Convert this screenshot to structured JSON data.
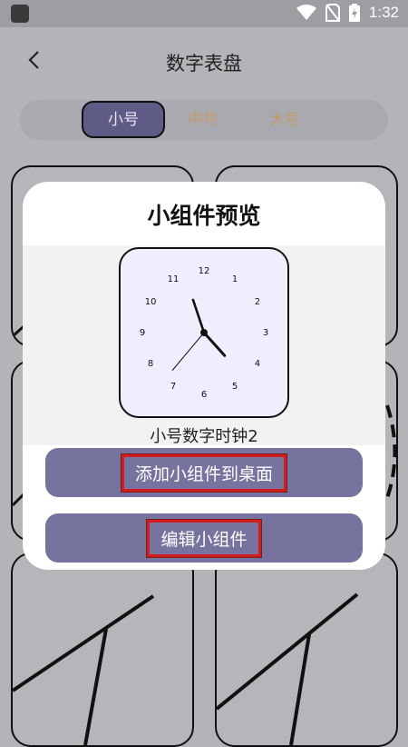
{
  "status_bar": {
    "time": "1:32"
  },
  "header": {
    "title": "数字表盘"
  },
  "tabs": [
    {
      "label": "小号",
      "selected": true
    },
    {
      "label": "中号",
      "selected": false
    },
    {
      "label": "大号",
      "selected": false
    }
  ],
  "modal": {
    "title": "小组件预览",
    "widget_name": "小号数字时钟2",
    "add_button": "添加小组件到桌面",
    "edit_button": "编辑小组件"
  },
  "clock": {
    "numbers": [
      "12",
      "1",
      "2",
      "3",
      "4",
      "5",
      "6",
      "7",
      "8",
      "9",
      "10",
      "11"
    ],
    "time_shown": "11:23"
  },
  "colors": {
    "accent": "#77739f",
    "tab_selected": "#5e5b86",
    "tab_unselected_text": "#c89a6b",
    "highlight_box": "#d31d1d"
  }
}
